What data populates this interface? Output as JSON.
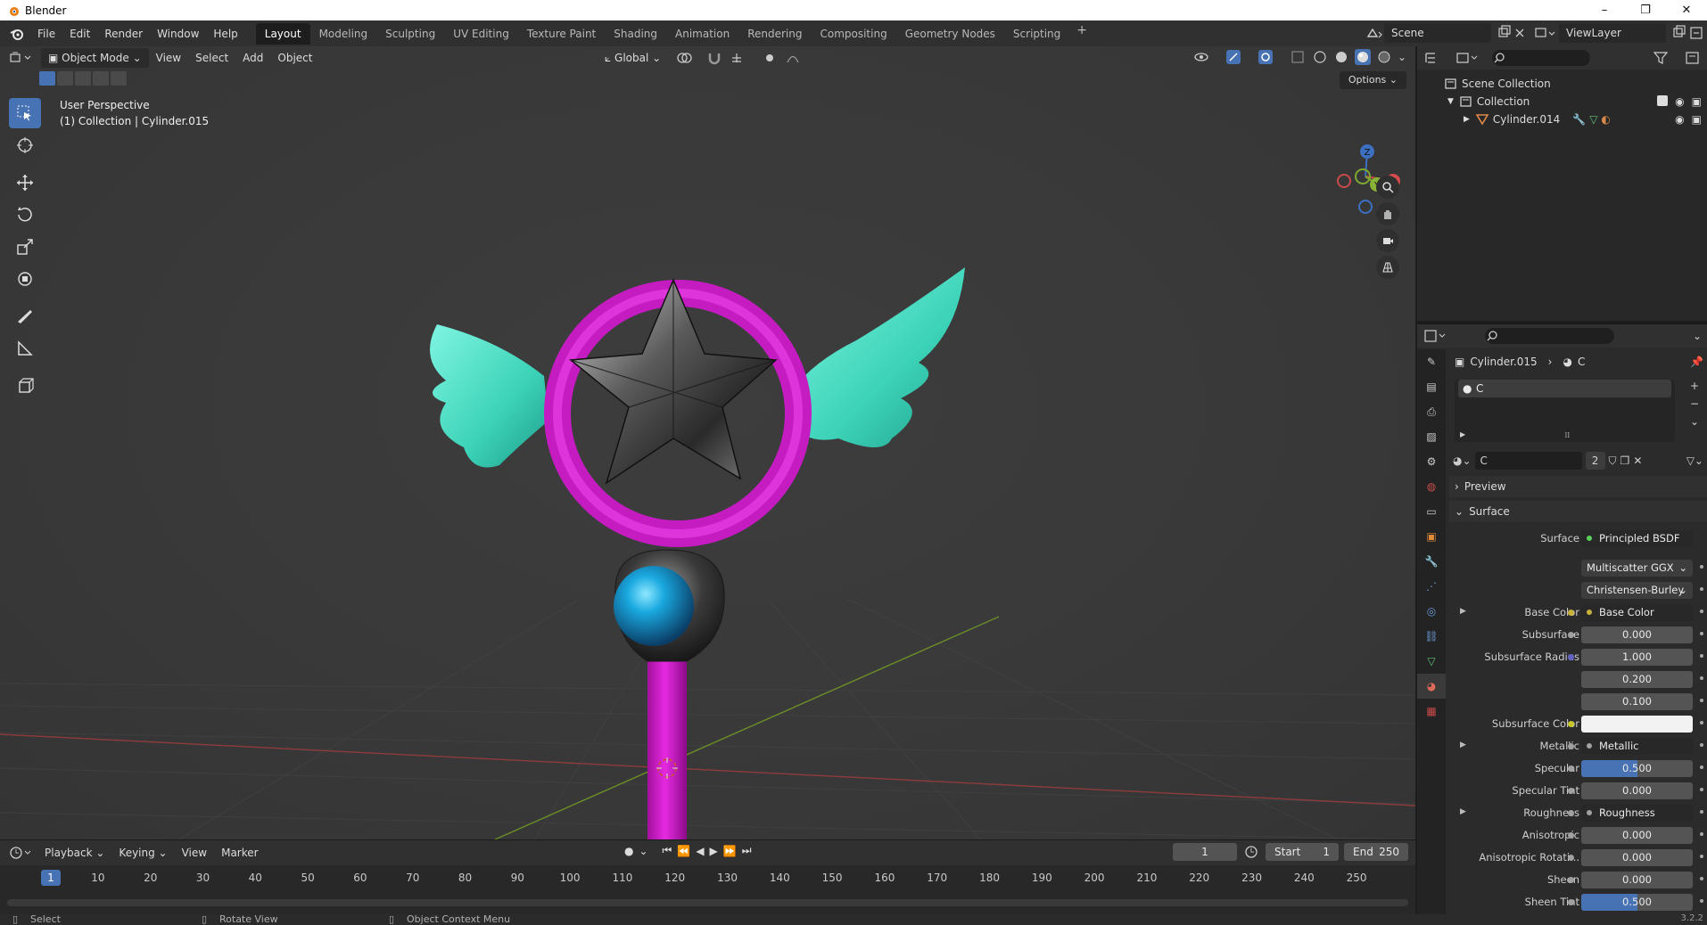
{
  "window": {
    "title": "Blender",
    "controls": [
      "–",
      "❐",
      "✕"
    ]
  },
  "menu": [
    "File",
    "Edit",
    "Render",
    "Window",
    "Help"
  ],
  "workspaces": [
    "Layout",
    "Modeling",
    "Sculpting",
    "UV Editing",
    "Texture Paint",
    "Shading",
    "Animation",
    "Rendering",
    "Compositing",
    "Geometry Nodes",
    "Scripting"
  ],
  "workspace_add": "+",
  "scene": {
    "name": "Scene",
    "view_layer": "ViewLayer"
  },
  "viewport": {
    "mode": "Object Mode",
    "menus": [
      "View",
      "Select",
      "Add",
      "Object"
    ],
    "orientation": "Global",
    "options_label": "Options",
    "info_line1": "User Perspective",
    "info_line2": "(1) Collection | Cylinder.015",
    "gizmo_labels": {
      "x": "X",
      "y": "Y",
      "z": "Z"
    }
  },
  "outliner": {
    "rows": [
      {
        "label": "Scene Collection"
      },
      {
        "label": "Collection"
      },
      {
        "label": "Cylinder.014"
      }
    ]
  },
  "properties": {
    "breadcrumb_object": "Cylinder.015",
    "breadcrumb_material": "C",
    "slot_name": "C",
    "material_name": "C",
    "material_users": "2",
    "panels": {
      "preview": "Preview",
      "surface": "Surface"
    },
    "surface_label": "Surface",
    "surface_shader": "Principled BSDF",
    "distribution": "Multiscatter GGX",
    "subsurface_method": "Christensen-Burley",
    "rows": [
      {
        "label": "Base Color",
        "value": "Base Color",
        "kind": "link",
        "dot": "#c7b13a",
        "expand": true
      },
      {
        "label": "Subsurface",
        "value": "0.000",
        "kind": "num"
      },
      {
        "label": "Subsurface Radius",
        "value": "1.000",
        "kind": "num",
        "sock": "#6363c7"
      },
      {
        "label": "",
        "value": "0.200",
        "kind": "num",
        "nosock": true
      },
      {
        "label": "",
        "value": "0.100",
        "kind": "num",
        "nosock": true
      },
      {
        "label": "Subsurface Color",
        "value": "",
        "kind": "color",
        "sock": "#c7c729"
      },
      {
        "label": "Metallic",
        "value": "Metallic",
        "kind": "link",
        "dot": "#a1a1a1",
        "expand": true
      },
      {
        "label": "Specular",
        "value": "0.500",
        "kind": "bar",
        "fill": 0.5
      },
      {
        "label": "Specular Tint",
        "value": "0.000",
        "kind": "num"
      },
      {
        "label": "Roughness",
        "value": "Roughness",
        "kind": "link",
        "dot": "#a1a1a1",
        "expand": true
      },
      {
        "label": "Anisotropic",
        "value": "0.000",
        "kind": "num"
      },
      {
        "label": "Anisotropic Rotati...",
        "value": "0.000",
        "kind": "num"
      },
      {
        "label": "Sheen",
        "value": "0.000",
        "kind": "num"
      },
      {
        "label": "Sheen Tint",
        "value": "0.500",
        "kind": "bar",
        "fill": 0.5
      }
    ]
  },
  "timeline": {
    "menus": [
      "Playback",
      "Keying",
      "View",
      "Marker"
    ],
    "current_frame": "1",
    "start_label": "Start",
    "start": "1",
    "end_label": "End",
    "end": "250",
    "ticks": [
      "1",
      "10",
      "20",
      "30",
      "40",
      "50",
      "60",
      "70",
      "80",
      "90",
      "100",
      "110",
      "120",
      "130",
      "140",
      "150",
      "160",
      "170",
      "180",
      "190",
      "200",
      "210",
      "220",
      "230",
      "240",
      "250"
    ]
  },
  "status": {
    "select": "Select",
    "rotate": "Rotate View",
    "context": "Object Context Menu",
    "version": "3.2.2"
  },
  "colors": {
    "accent": "#4772b3",
    "ring": "#d61fd6",
    "wings": "#4fe0c8",
    "orb": "#1aa9e0"
  }
}
